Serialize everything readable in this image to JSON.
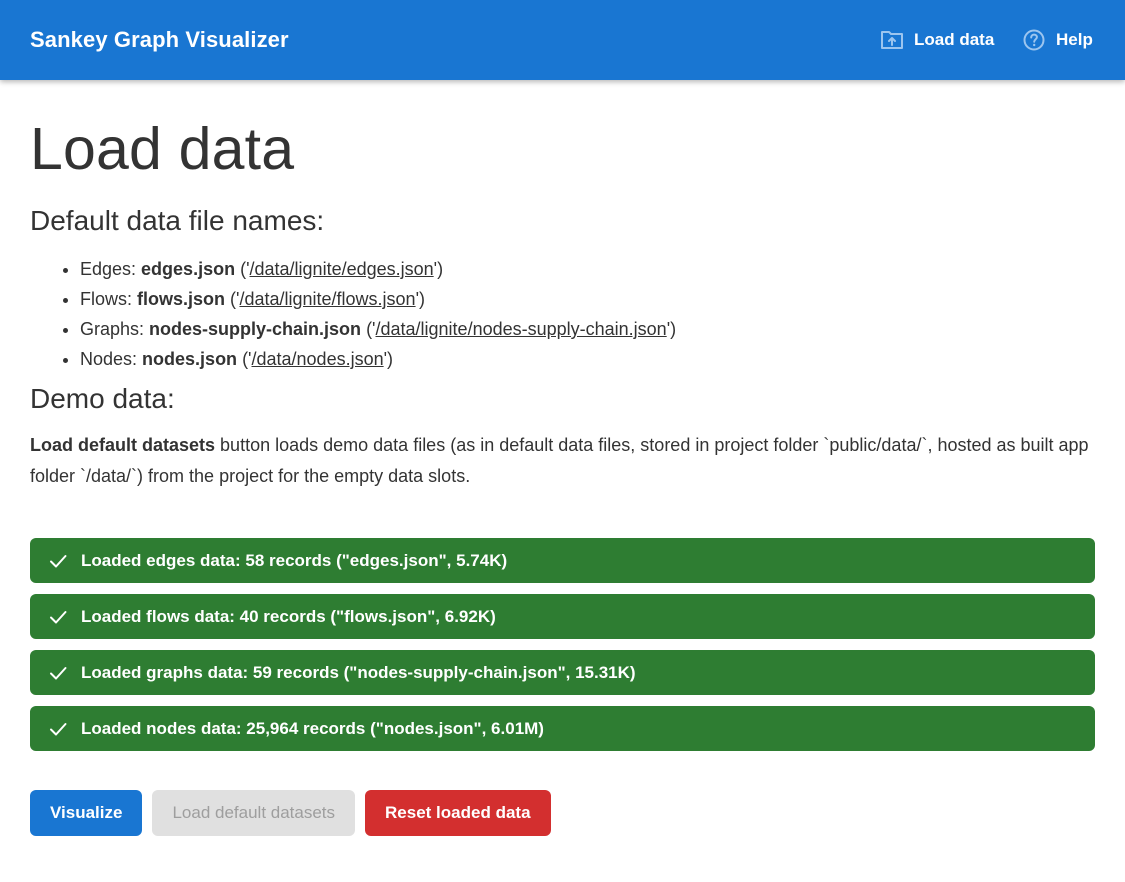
{
  "app": {
    "title": "Sankey Graph Visualizer",
    "nav": [
      {
        "label": "Load data",
        "icon": "folder-upload-icon"
      },
      {
        "label": "Help",
        "icon": "help-circle-icon"
      }
    ]
  },
  "page": {
    "title": "Load data",
    "defaults_heading": "Default data file names:",
    "files": [
      {
        "prefix": "Edges: ",
        "name": "edges.json",
        "open": " ('",
        "path": "/data/lignite/edges.json",
        "close": "')"
      },
      {
        "prefix": "Flows: ",
        "name": "flows.json",
        "open": " ('",
        "path": "/data/lignite/flows.json",
        "close": "')"
      },
      {
        "prefix": "Graphs: ",
        "name": "nodes-supply-chain.json",
        "open": " ('",
        "path": "/data/lignite/nodes-supply-chain.json",
        "close": "')"
      },
      {
        "prefix": "Nodes: ",
        "name": "nodes.json",
        "open": " ('",
        "path": "/data/nodes.json",
        "close": "')"
      }
    ],
    "demo_heading": "Demo data:",
    "demo_bold": "Load default datasets",
    "demo_text": " button loads demo data files (as in default data files, stored in project folder `public/data/`, hosted as built app folder `/data/`) from the project for the empty data slots."
  },
  "alerts": [
    {
      "text": "Loaded edges data: 58 records (\"edges.json\", 5.74K)"
    },
    {
      "text": "Loaded flows data: 40 records (\"flows.json\", 6.92K)"
    },
    {
      "text": "Loaded graphs data: 59 records (\"nodes-supply-chain.json\", 15.31K)"
    },
    {
      "text": "Loaded nodes data: 25,964 records (\"nodes.json\", 6.01M)"
    }
  ],
  "actions": {
    "visualize": "Visualize",
    "load_default": "Load default datasets",
    "reset": "Reset loaded data"
  },
  "colors": {
    "primary": "#1976d2",
    "success": "#2e7d32",
    "danger": "#d32f2f",
    "disabled_bg": "#e0e0e0",
    "disabled_text": "#9e9e9e"
  }
}
